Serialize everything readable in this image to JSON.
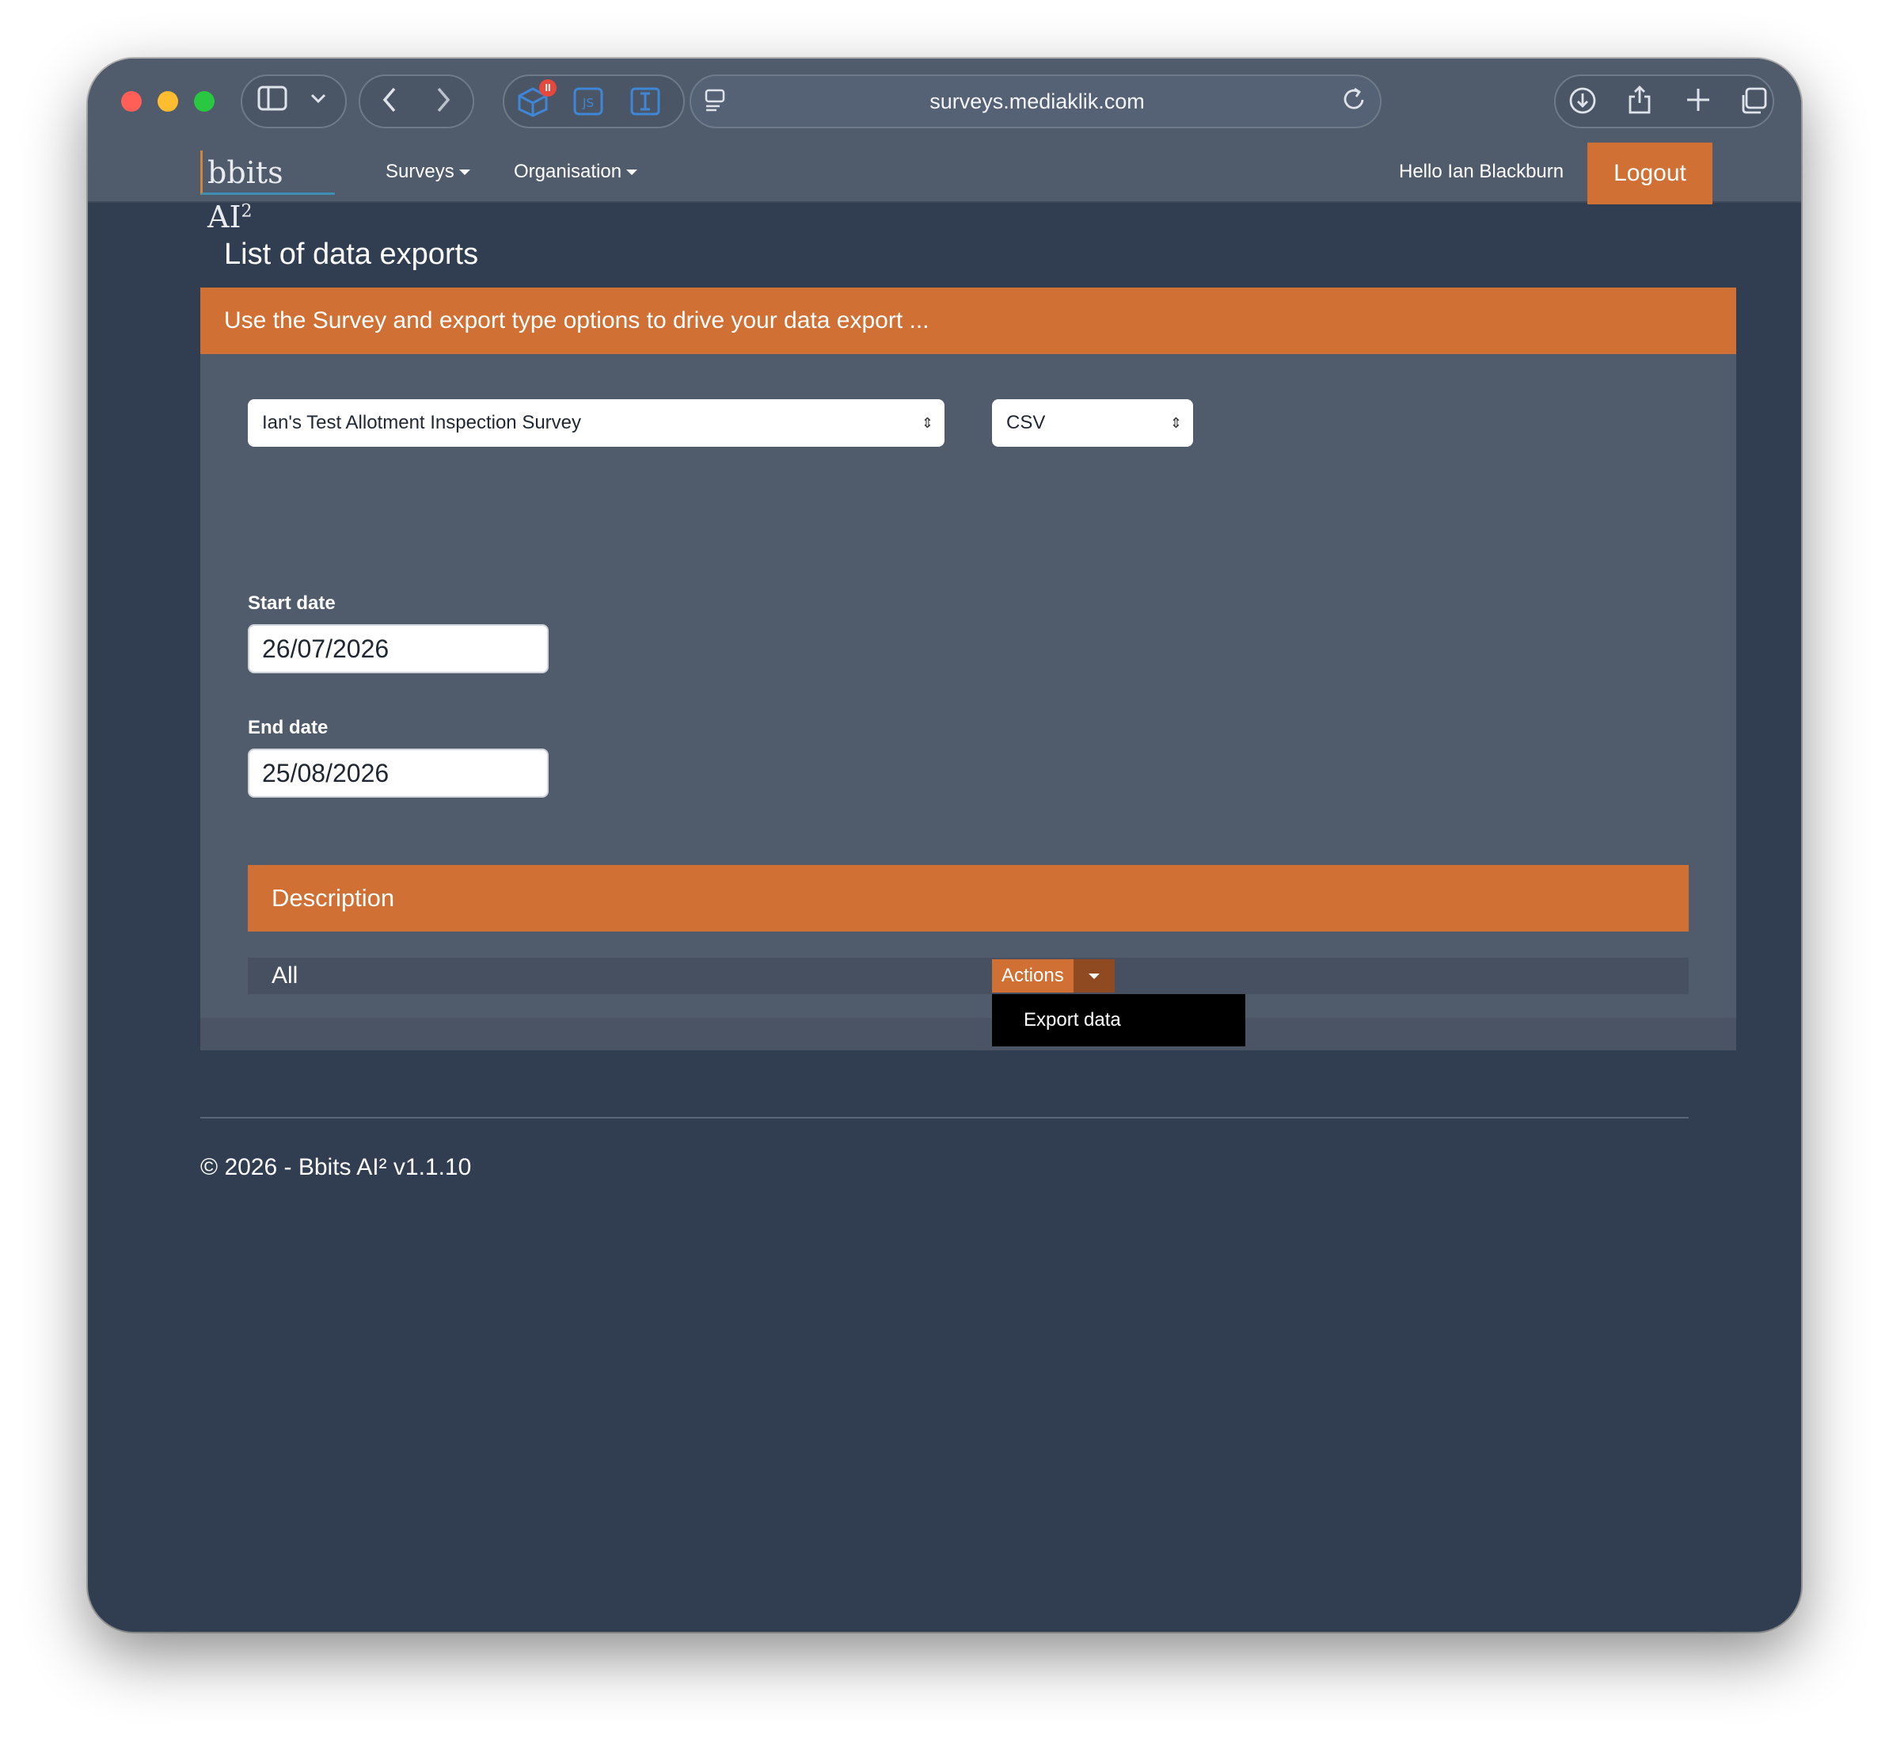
{
  "browser": {
    "url": "surveys.mediaklik.com",
    "icons": [
      "sidebar-icon",
      "chevron-down-icon",
      "back-icon",
      "forward-icon",
      "extension-cube-icon",
      "js-extension-icon",
      "text-cursor-extension-icon",
      "reader-icon",
      "reload-icon",
      "download-icon",
      "share-icon",
      "new-tab-icon",
      "tabs-overview-icon"
    ],
    "extension_badge": "II"
  },
  "navbar": {
    "brand": "bbits AI",
    "brand_sup": "2",
    "surveys": "Surveys",
    "organisation": "Organisation",
    "greeting": "Hello Ian Blackburn",
    "logout": "Logout"
  },
  "page": {
    "title": "List of data exports",
    "banner": "Use the Survey and export type options to drive your data export ...",
    "survey_select": "Ian's Test Allotment Inspection Survey",
    "type_select": "CSV",
    "start_label": "Start date",
    "start_value": "26/07/2026",
    "end_label": "End date",
    "end_value": "25/08/2026",
    "table_header": "Description",
    "rows": [
      {
        "description": "All",
        "action": "Actions"
      }
    ],
    "menu_items": [
      "Export data"
    ]
  },
  "footer": {
    "text": "© 2026 - Bbits AI² v1.1.10"
  },
  "colors": {
    "accent": "#d07034",
    "background": "#313d50",
    "panel": "#505b6b"
  }
}
